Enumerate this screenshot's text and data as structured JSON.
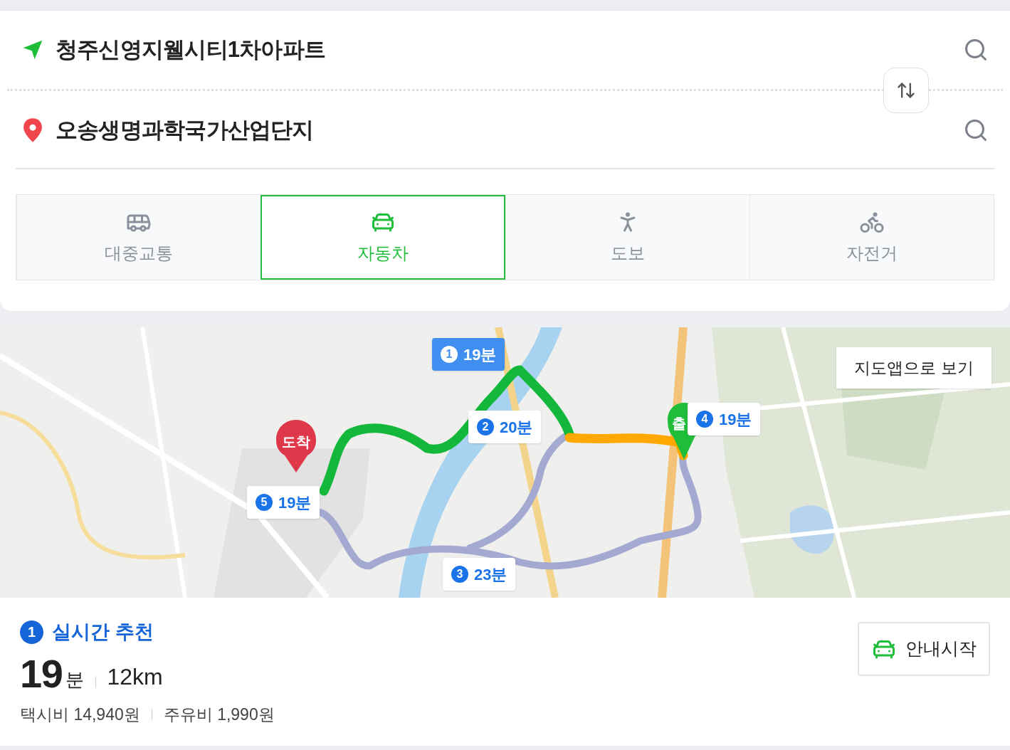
{
  "origin": {
    "text": "청주신영지웰시티1차아파트"
  },
  "destination": {
    "text": "오송생명과학국가산업단지"
  },
  "modes": [
    {
      "kind": "bus",
      "label": "대중교통",
      "selected": false
    },
    {
      "kind": "car",
      "label": "자동차",
      "selected": true
    },
    {
      "kind": "walk",
      "label": "도보",
      "selected": false
    },
    {
      "kind": "bike",
      "label": "자전거",
      "selected": false
    }
  ],
  "map": {
    "view_button": "지도앱으로 보기",
    "arrival_pin": "도착",
    "start_pin": "출",
    "routes": [
      {
        "number": "1",
        "time": "19분",
        "selected": true
      },
      {
        "number": "2",
        "time": "20분",
        "selected": false
      },
      {
        "number": "3",
        "time": "23분",
        "selected": false
      },
      {
        "number": "4",
        "time": "19분",
        "selected": false
      },
      {
        "number": "5",
        "time": "19분",
        "selected": false
      }
    ]
  },
  "summary": {
    "number": "1",
    "title": "실시간 추천",
    "minutes": "19",
    "minutes_unit": "분",
    "distance": "12km",
    "taxi_fare": "택시비 14,940원",
    "fuel_cost": "주유비 1,990원",
    "start_button": "안내시작"
  }
}
